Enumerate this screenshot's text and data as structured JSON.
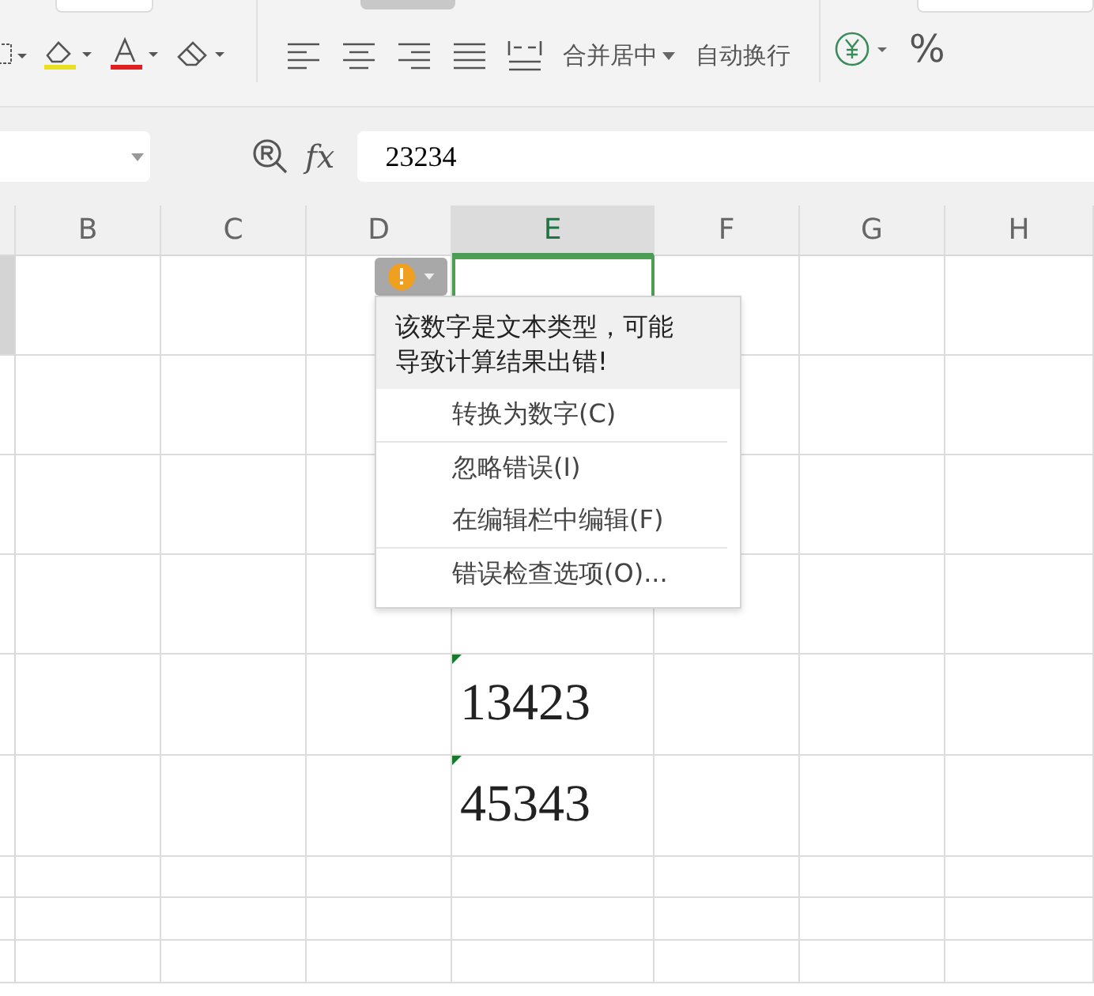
{
  "toolbar": {
    "merge_label": "合并居中",
    "wrap_label": "自动换行",
    "percent_label": "%"
  },
  "formula_bar": {
    "fx_label": "fx",
    "value": "23234"
  },
  "columns": [
    {
      "label": "B",
      "selected": false
    },
    {
      "label": "C",
      "selected": false
    },
    {
      "label": "D",
      "selected": false
    },
    {
      "label": "E",
      "selected": true
    },
    {
      "label": "F",
      "selected": false
    },
    {
      "label": "G",
      "selected": false
    },
    {
      "label": "H",
      "selected": false
    }
  ],
  "rows": [
    {
      "selected": true
    },
    {
      "selected": false
    },
    {
      "selected": false
    },
    {
      "selected": false
    },
    {
      "value": "13423",
      "selected": false,
      "number_as_text": true
    },
    {
      "value": "45343",
      "selected": false,
      "number_as_text": true
    },
    {
      "selected": false,
      "number_as_text": false
    },
    {
      "selected": false,
      "number_as_text": false
    },
    {
      "selected": false,
      "number_as_text": false
    }
  ],
  "error_menu": {
    "message": "该数字是文本类型，可能导致计算结果出错!",
    "items": [
      {
        "label": "转换为数字(C)",
        "separator_after": true
      },
      {
        "label": "忽略错误(I)",
        "separator_after": false
      },
      {
        "label": "在编辑栏中编辑(F)",
        "separator_after": true
      },
      {
        "label": "错误检查选项(O)...",
        "separator_after": false
      }
    ]
  }
}
